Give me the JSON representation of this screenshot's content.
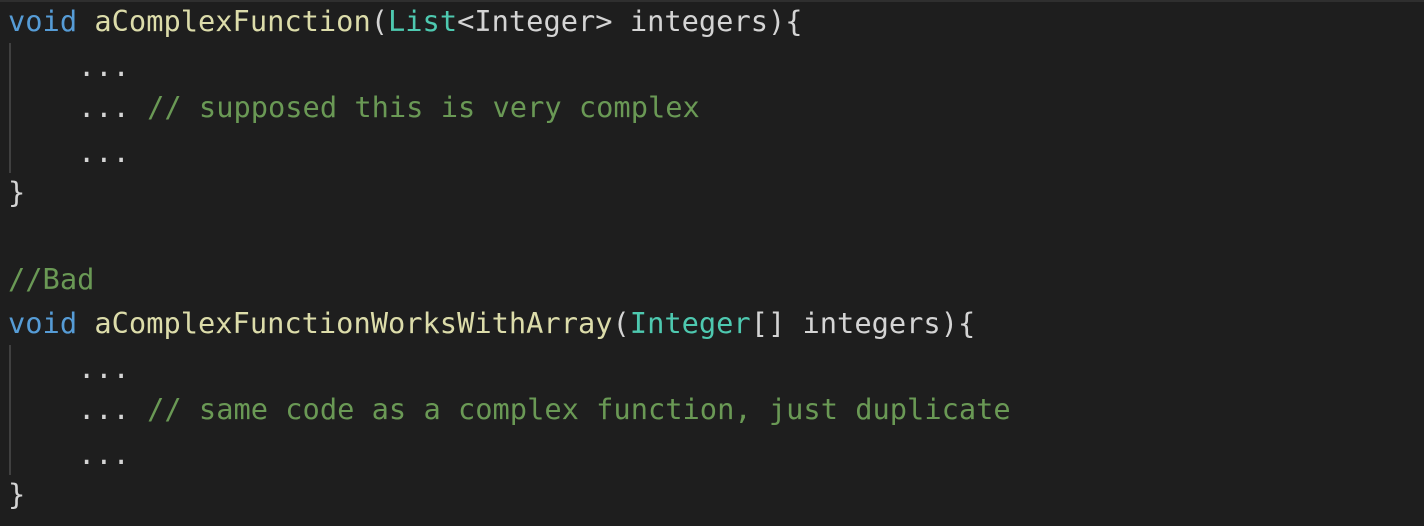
{
  "code": {
    "block1": {
      "keyword": "void",
      "function_name": "aComplexFunction",
      "open_paren": "(",
      "param_type": "List",
      "generic": "<Integer>",
      "param_rest": " integers){",
      "body": [
        {
          "text": "...",
          "comment": ""
        },
        {
          "text": "...",
          "comment": "// supposed this is very complex"
        },
        {
          "text": "...",
          "comment": ""
        }
      ],
      "close": "}"
    },
    "separator_comment": "//Bad",
    "block2": {
      "keyword": "void",
      "function_name": "aComplexFunctionWorksWithArray",
      "open_paren": "(",
      "param_type": "Integer",
      "param_rest": "[] integers){",
      "body": [
        {
          "text": "...",
          "comment": ""
        },
        {
          "text": "...",
          "comment": "// same code as a complex function, just duplicate"
        },
        {
          "text": "...",
          "comment": ""
        }
      ],
      "close": "}"
    }
  },
  "colors": {
    "background": "#1e1e1e",
    "keyword": "#569cd6",
    "function": "#dcdcaa",
    "type": "#4ec9b0",
    "comment": "#6a9955",
    "text": "#d4d4d4"
  }
}
